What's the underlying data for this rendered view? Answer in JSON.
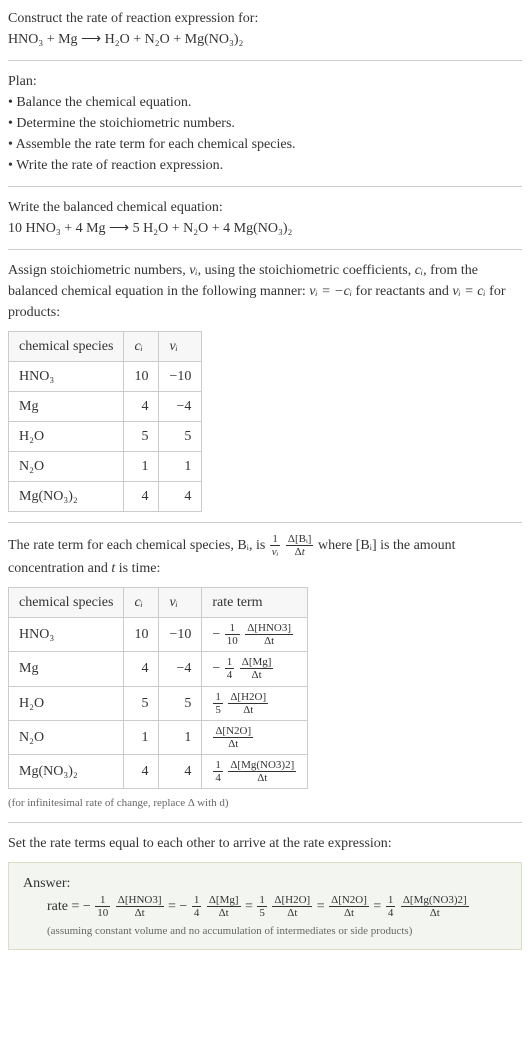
{
  "intro": {
    "prompt": "Construct the rate of reaction expression for:",
    "equation": "HNO₃ + Mg ⟶ H₂O + N₂O + Mg(NO₃)₂"
  },
  "plan": {
    "title": "Plan:",
    "items": [
      "Balance the chemical equation.",
      "Determine the stoichiometric numbers.",
      "Assemble the rate term for each chemical species.",
      "Write the rate of reaction expression."
    ]
  },
  "balanced": {
    "title": "Write the balanced chemical equation:",
    "equation": "10 HNO₃ + 4 Mg ⟶ 5 H₂O + N₂O + 4 Mg(NO₃)₂"
  },
  "assign": {
    "text_a": "Assign stoichiometric numbers, ",
    "nu_i": "νᵢ",
    "text_b": ", using the stoichiometric coefficients, ",
    "c_i": "cᵢ",
    "text_c": ", from the balanced chemical equation in the following manner: ",
    "eq1": "νᵢ = −cᵢ",
    "text_d": " for reactants and ",
    "eq2": "νᵢ = cᵢ",
    "text_e": " for products:"
  },
  "table1": {
    "headers": [
      "chemical species",
      "cᵢ",
      "νᵢ"
    ],
    "rows": [
      {
        "species": "HNO₃",
        "c": "10",
        "nu": "−10"
      },
      {
        "species": "Mg",
        "c": "4",
        "nu": "−4"
      },
      {
        "species": "H₂O",
        "c": "5",
        "nu": "5"
      },
      {
        "species": "N₂O",
        "c": "1",
        "nu": "1"
      },
      {
        "species": "Mg(NO₃)₂",
        "c": "4",
        "nu": "4"
      }
    ]
  },
  "rateterm_text": {
    "a": "The rate term for each chemical species, Bᵢ, is ",
    "b": " where [Bᵢ] is the amount concentration and ",
    "t": "t",
    "c": " is time:"
  },
  "table2": {
    "headers": [
      "chemical species",
      "cᵢ",
      "νᵢ",
      "rate term"
    ],
    "rows": [
      {
        "species": "HNO₃",
        "c": "10",
        "nu": "−10",
        "sign": "−",
        "coef_num": "1",
        "coef_den": "10",
        "dnum": "Δ[HNO3]",
        "dden": "Δt"
      },
      {
        "species": "Mg",
        "c": "4",
        "nu": "−4",
        "sign": "−",
        "coef_num": "1",
        "coef_den": "4",
        "dnum": "Δ[Mg]",
        "dden": "Δt"
      },
      {
        "species": "H₂O",
        "c": "5",
        "nu": "5",
        "sign": "",
        "coef_num": "1",
        "coef_den": "5",
        "dnum": "Δ[H2O]",
        "dden": "Δt"
      },
      {
        "species": "N₂O",
        "c": "1",
        "nu": "1",
        "sign": "",
        "coef_num": "",
        "coef_den": "",
        "dnum": "Δ[N2O]",
        "dden": "Δt"
      },
      {
        "species": "Mg(NO₃)₂",
        "c": "4",
        "nu": "4",
        "sign": "",
        "coef_num": "1",
        "coef_den": "4",
        "dnum": "Δ[Mg(NO3)2]",
        "dden": "Δt"
      }
    ]
  },
  "note_infinitesimal": "(for infinitesimal rate of change, replace Δ with d)",
  "set_equal": "Set the rate terms equal to each other to arrive at the rate expression:",
  "answer": {
    "title": "Answer:",
    "prefix": "rate = ",
    "terms": [
      {
        "sign": "−",
        "coef_num": "1",
        "coef_den": "10",
        "dnum": "Δ[HNO3]",
        "dden": "Δt"
      },
      {
        "sign": "−",
        "coef_num": "1",
        "coef_den": "4",
        "dnum": "Δ[Mg]",
        "dden": "Δt"
      },
      {
        "sign": "",
        "coef_num": "1",
        "coef_den": "5",
        "dnum": "Δ[H2O]",
        "dden": "Δt"
      },
      {
        "sign": "",
        "coef_num": "",
        "coef_den": "",
        "dnum": "Δ[N2O]",
        "dden": "Δt"
      },
      {
        "sign": "",
        "coef_num": "1",
        "coef_den": "4",
        "dnum": "Δ[Mg(NO3)2]",
        "dden": "Δt"
      }
    ],
    "note": "(assuming constant volume and no accumulation of intermediates or side products)"
  },
  "chart_data": {
    "type": "table",
    "title": "Stoichiometric numbers and rate terms",
    "tables": [
      {
        "columns": [
          "chemical species",
          "c_i",
          "nu_i"
        ],
        "rows": [
          [
            "HNO3",
            10,
            -10
          ],
          [
            "Mg",
            4,
            -4
          ],
          [
            "H2O",
            5,
            5
          ],
          [
            "N2O",
            1,
            1
          ],
          [
            "Mg(NO3)2",
            4,
            4
          ]
        ]
      },
      {
        "columns": [
          "chemical species",
          "c_i",
          "nu_i",
          "rate term"
        ],
        "rows": [
          [
            "HNO3",
            10,
            -10,
            "-(1/10) Δ[HNO3]/Δt"
          ],
          [
            "Mg",
            4,
            -4,
            "-(1/4) Δ[Mg]/Δt"
          ],
          [
            "H2O",
            5,
            5,
            "(1/5) Δ[H2O]/Δt"
          ],
          [
            "N2O",
            1,
            1,
            "Δ[N2O]/Δt"
          ],
          [
            "Mg(NO3)2",
            4,
            4,
            "(1/4) Δ[Mg(NO3)2]/Δt"
          ]
        ]
      }
    ],
    "rate_expression": "rate = -(1/10) Δ[HNO3]/Δt = -(1/4) Δ[Mg]/Δt = (1/5) Δ[H2O]/Δt = Δ[N2O]/Δt = (1/4) Δ[Mg(NO3)2]/Δt"
  }
}
